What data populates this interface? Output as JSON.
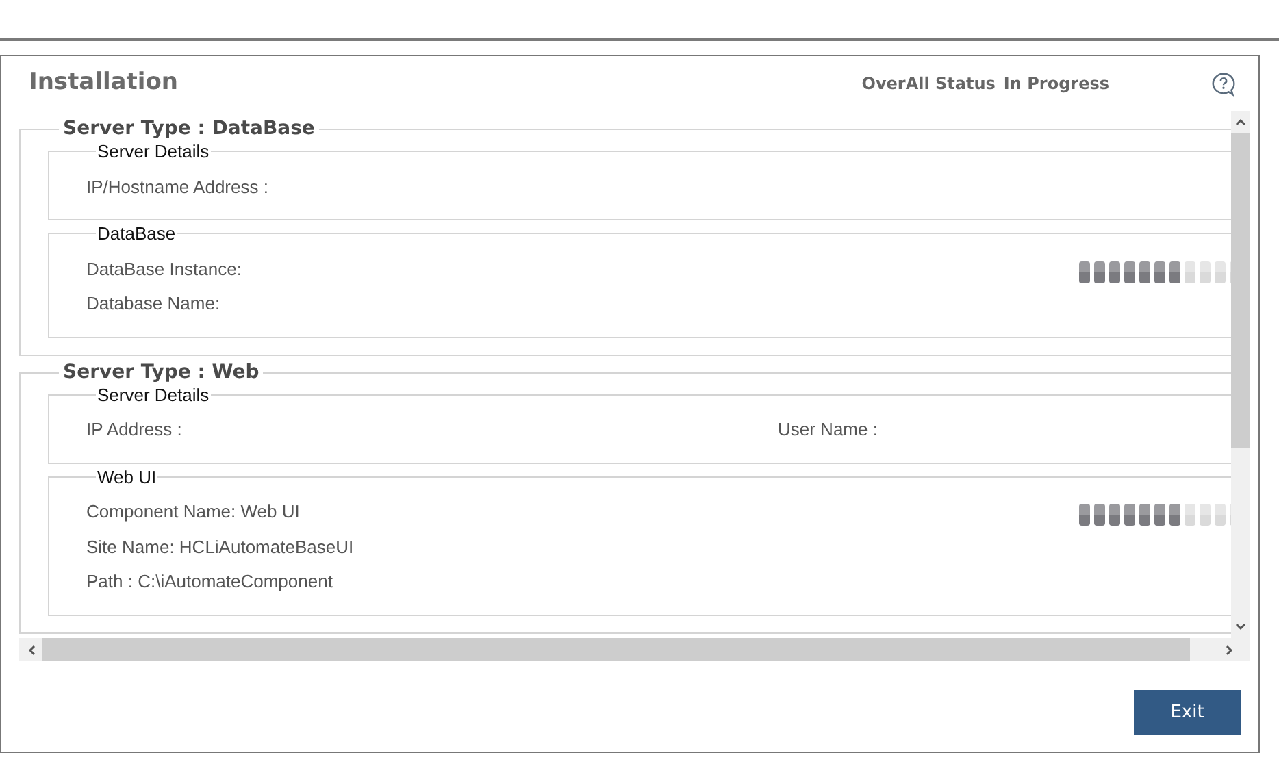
{
  "title": "Installation",
  "overall_status": {
    "label": "OverAll Status",
    "value": "In Progress"
  },
  "sections": [
    {
      "title": "Server Type : DataBase",
      "groups": [
        {
          "title": "Server Details",
          "rows": [
            [
              "IP/Hostname Address :"
            ]
          ]
        },
        {
          "title": "DataBase",
          "progress": {
            "level": 0.64
          },
          "rows": [
            [
              "DataBase Instance:"
            ],
            [
              "Database Name:"
            ]
          ]
        }
      ]
    },
    {
      "title": "Server Type : Web",
      "groups": [
        {
          "title": "Server Details",
          "rows": [
            [
              "IP Address :",
              "User Name :"
            ]
          ]
        },
        {
          "title": "Web UI",
          "progress": {
            "level": 0.64
          },
          "rows": [
            [
              "Component Name: Web UI"
            ],
            [
              "Site Name: HCLiAutomateBaseUI"
            ],
            [
              "Path : C:\\iAutomateComponent"
            ]
          ]
        }
      ]
    }
  ],
  "exit_button": "Exit"
}
